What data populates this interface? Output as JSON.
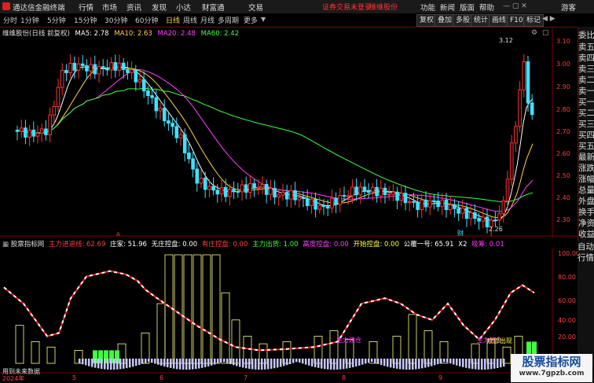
{
  "menubar": {
    "app_title": "通达信金融终端",
    "menus": [
      "行情",
      "市场",
      "资讯",
      "发现",
      "小达",
      "财富通",
      "交易"
    ],
    "login_notice": "证券交易未登录",
    "account_notice": "维维股份",
    "right_menus": [
      "功能",
      "新闻",
      "版面",
      "帮助"
    ],
    "guest_label": "游客"
  },
  "toolbar": {
    "periods": [
      "分时",
      "1分钟",
      "5分钟",
      "15分钟",
      "30分钟",
      "60分钟",
      "日线",
      "周线",
      "月线",
      "多周期",
      "更多"
    ],
    "active_period": "日线",
    "right_buttons": [
      "复权",
      "叠加",
      "多股",
      "统计",
      "画线",
      "F10",
      "标记"
    ]
  },
  "main_chart": {
    "title": "维维股份(日线 前复权)",
    "ma_legend": [
      {
        "label": "MA5: 2.78",
        "color": "#ffffff"
      },
      {
        "label": "MA10: 2.63",
        "color": "#ffd34d"
      },
      {
        "label": "MA20: 2.48",
        "color": "#ff40ff"
      },
      {
        "label": "MA60: 2.42",
        "color": "#40ff40"
      }
    ],
    "y_ticks": [
      "3.10",
      "3.00",
      "2.90",
      "2.80",
      "2.70",
      "2.60",
      "2.50",
      "2.40",
      "2.30"
    ],
    "high_label": "3.12",
    "low_label": "2.26",
    "marker_label": "财",
    "arrow_marker": "A"
  },
  "indicator": {
    "title": "股票指标网",
    "items": [
      {
        "label": "主力进退线: 62.69",
        "color": "#ff4040"
      },
      {
        "label": "庄家: 51.96",
        "color": "#ffffff"
      },
      {
        "label": "无庄控盘: 0.00",
        "color": "#ffffff"
      },
      {
        "label": "有庄控盘: 0.00",
        "color": "#ff4040"
      },
      {
        "label": "主力出货: 1.00",
        "color": "#40ff40"
      },
      {
        "label": "高度控盘: 0.00",
        "color": "#ff40ff"
      },
      {
        "label": "开始控盘: 0.00",
        "color": "#ffff40"
      },
      {
        "label": "公覆一号: 65.91",
        "color": "#ffffff"
      },
      {
        "label": "X2",
        "color": "#ffffff"
      },
      {
        "label": "吸筹: 0.01",
        "color": "#ff40ff"
      }
    ],
    "y_ticks": [
      "100.00",
      "80.00",
      "60.00",
      "40.00",
      "20.00"
    ],
    "annotations": [
      "主力建仓",
      "主力建仓",
      "底部出现"
    ],
    "footer_note": "用到未来数据"
  },
  "x_axis": {
    "labels": [
      "2024年",
      "5",
      "6",
      "7",
      "8",
      "9"
    ]
  },
  "sidebar": {
    "tabs": [
      "委比",
      "卖五",
      "卖四",
      "卖三",
      "卖二",
      "卖一",
      "买一",
      "买二",
      "买三",
      "买四",
      "买五",
      "最新",
      "涨跌",
      "涨幅",
      "总量",
      "外盘",
      "换手",
      "净资",
      "收益"
    ],
    "bottom_tabs": [
      "自动",
      "行情"
    ]
  },
  "watermark": {
    "title": "股票指标网",
    "url": "www.7gpzb.com"
  },
  "colors": {
    "up": "#ff3333",
    "down": "#40e0ff",
    "ma5": "#ffffff",
    "ma10": "#ffd34d",
    "ma20": "#ff40ff",
    "ma60": "#40ff40"
  }
}
